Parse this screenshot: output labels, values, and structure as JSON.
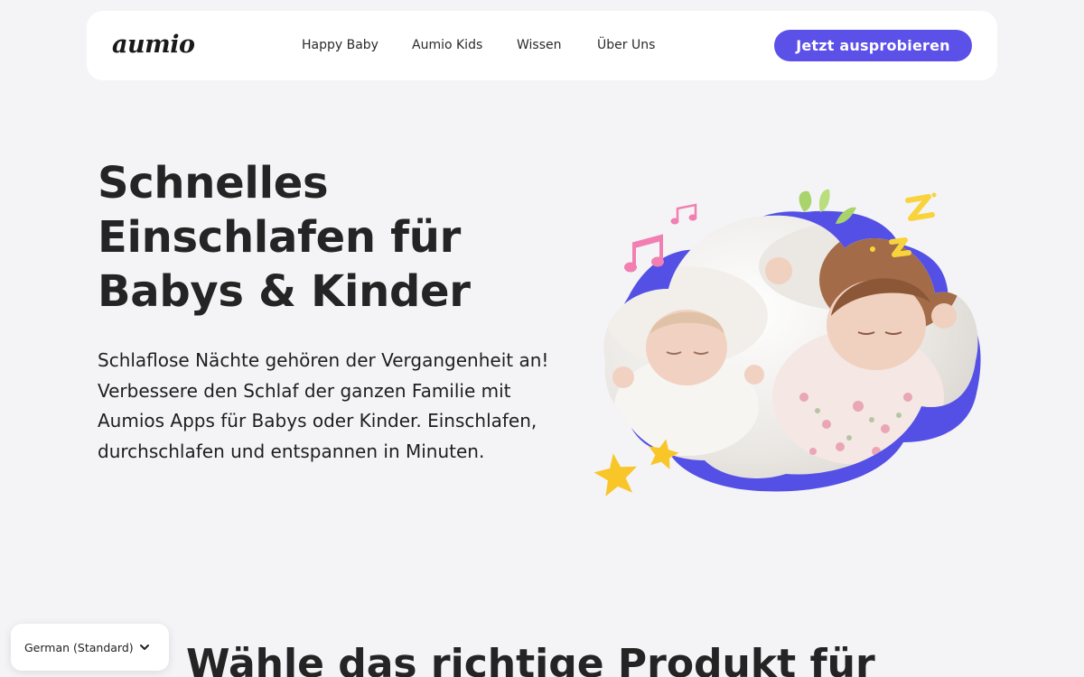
{
  "header": {
    "logo_text": "aumio",
    "nav": [
      {
        "label": "Happy Baby"
      },
      {
        "label": "Aumio Kids"
      },
      {
        "label": "Wissen"
      },
      {
        "label": "Über Uns"
      }
    ],
    "cta_label": "Jetzt ausprobieren"
  },
  "hero": {
    "title": "Schnelles Einschlafen für Babys & Kinder",
    "text": "Schlaflose Nächte gehören der Vergangenheit an! Verbessere den Schlaf der ganzen Familie mit Aumios Apps für Babys oder Kinder. Einschlafen, durchschlafen und entspannen in Minuten."
  },
  "section": {
    "title": "Wähle das richtige Produkt für"
  },
  "language_selector": {
    "value": "German (Standard)"
  },
  "colors": {
    "accent": "#5b50e8",
    "background": "#f4f4f6",
    "star": "#f9c62a",
    "music_note": "#f27fb1",
    "leaf": "#a9d36b"
  },
  "icons": [
    "chevron-down-icon",
    "music-note-icon",
    "star-icon",
    "zzz-icon",
    "leaf-icon"
  ]
}
